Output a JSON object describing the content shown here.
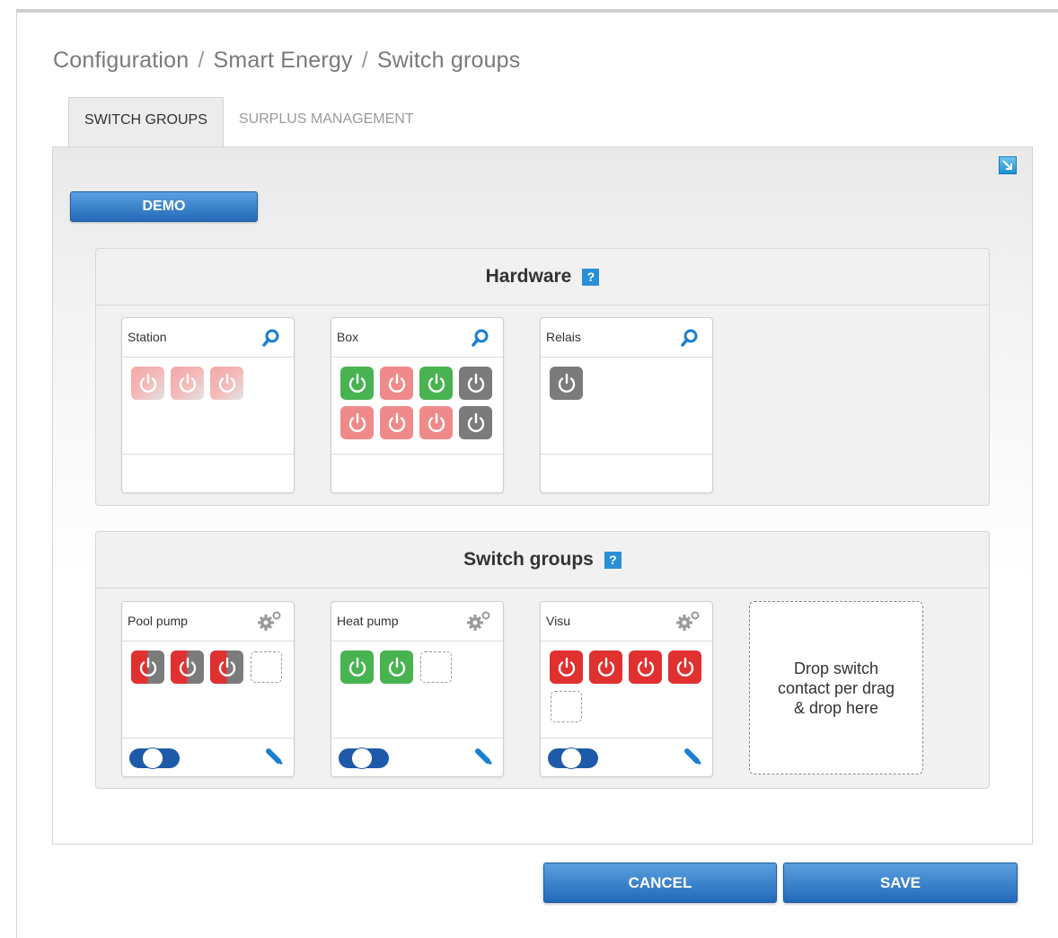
{
  "breadcrumb": {
    "part1": "Configuration",
    "part2": "Smart Energy",
    "part3": "Switch groups",
    "separator": "/"
  },
  "tabs": [
    {
      "label": "SWITCH GROUPS",
      "active": true
    },
    {
      "label": "SURPLUS MANAGEMENT",
      "active": false
    }
  ],
  "demo_button": "DEMO",
  "hardware": {
    "title": "Hardware",
    "help": "?",
    "cards": [
      {
        "title": "Station",
        "switches": [
          "faded",
          "faded",
          "faded"
        ]
      },
      {
        "title": "Box",
        "switches": [
          "green",
          "salmon",
          "green",
          "gray",
          "salmon",
          "salmon",
          "salmon",
          "gray"
        ]
      },
      {
        "title": "Relais",
        "switches": [
          "gray"
        ]
      }
    ]
  },
  "switch_groups": {
    "title": "Switch groups",
    "help": "?",
    "cards": [
      {
        "title": "Pool pump",
        "switches": [
          "dual",
          "dual",
          "dual"
        ],
        "enabled": true
      },
      {
        "title": "Heat pump",
        "switches": [
          "green",
          "green"
        ],
        "enabled": true
      },
      {
        "title": "Visu",
        "switches": [
          "red",
          "red",
          "red",
          "red"
        ],
        "enabled": true
      }
    ],
    "dropzone_text": "Drop switch contact per drag & drop here"
  },
  "buttons": {
    "cancel": "CANCEL",
    "save": "SAVE"
  },
  "colors": {
    "accent_blue": "#2369b8",
    "switch_green": "#48b350",
    "switch_red": "#e03030",
    "switch_salmon": "#f08a8a",
    "switch_gray": "#7b7b7b"
  }
}
